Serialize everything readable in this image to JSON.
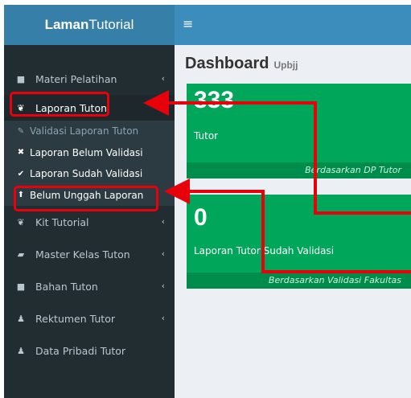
{
  "logo": {
    "bold": "Laman",
    "rest": "Tutorial"
  },
  "header": {
    "menu_icon": "≡"
  },
  "page": {
    "title": "Dashboard",
    "subtitle": "Upbjj"
  },
  "sidebar": {
    "items": [
      {
        "label": "Materi Pelatihan",
        "icon": "folder-icon",
        "has_arrow": true
      },
      {
        "label": "Laporan Tuton",
        "icon": "leaf-icon",
        "has_arrow": false,
        "active": true
      },
      {
        "label": "Kit Tutorial",
        "icon": "leaf-icon",
        "has_arrow": true
      },
      {
        "label": "Master Kelas Tuton",
        "icon": "book-icon",
        "has_arrow": true
      },
      {
        "label": "Bahan Tuton",
        "icon": "folder-icon",
        "has_arrow": true
      },
      {
        "label": "Rektumen Tutor",
        "icon": "user-plus-icon",
        "has_arrow": true
      },
      {
        "label": "Data Pribadi Tutor",
        "icon": "user-icon",
        "has_arrow": false
      }
    ],
    "submenu": [
      {
        "label": "Validasi Laporan Tuton",
        "icon": "edit-icon"
      },
      {
        "label": "Laporan Belum Validasi",
        "icon": "close-icon"
      },
      {
        "label": "Laporan Sudah Validasi",
        "icon": "check-icon"
      },
      {
        "label": "Belum Unggah Laporan",
        "icon": "upload-icon"
      }
    ],
    "arrow_glyph": "‹"
  },
  "boxes": [
    {
      "number": "333",
      "label": "Tutor",
      "footer": "Berdasarkan DP Tutor"
    },
    {
      "number": "0",
      "label": "Laporan Tutor Sudah Validasi",
      "footer": "Berdasarkan Validasi Fakultas"
    }
  ],
  "colors": {
    "sidebar": "#222d32",
    "logo": "#367fa9",
    "header": "#3c8dbc",
    "box": "#00a65a",
    "annotation": "#e8000a"
  }
}
